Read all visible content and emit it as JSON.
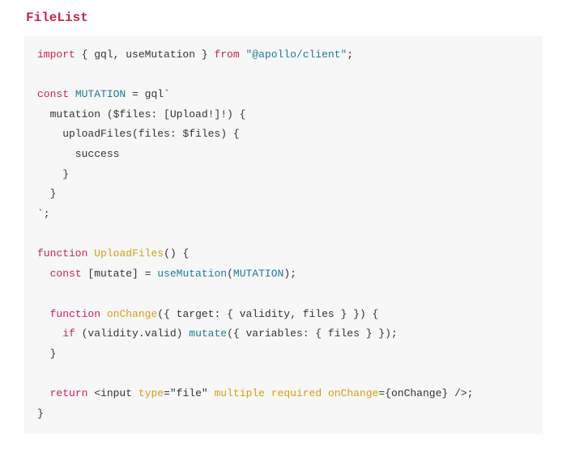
{
  "title": "FileList",
  "code": {
    "l1": {
      "kw1": "import",
      "p1": " { gql, useMutation } ",
      "kw2": "from",
      "p2": " ",
      "str": "\"@apollo/client\"",
      "p3": ";"
    },
    "l2": "",
    "l3": {
      "kw": "const",
      "sp": " ",
      "name": "MUTATION",
      "eq": " = gql`"
    },
    "l4": "  mutation ($files: [Upload!]!) {",
    "l5": "    uploadFiles(files: $files) {",
    "l6": "      success",
    "l7": "    }",
    "l8": "  }",
    "l9": "`;",
    "l10": "",
    "l11": {
      "kw": "function",
      "sp": " ",
      "name": "UploadFiles",
      "rest": "() {"
    },
    "l12": {
      "ind": "  ",
      "kw": "const",
      "p1": " [mutate] = ",
      "fn": "useMutation",
      "p2": "(",
      "arg": "MUTATION",
      "p3": ");"
    },
    "l13": "",
    "l14": {
      "ind": "  ",
      "kw": "function",
      "sp": " ",
      "name": "onChange",
      "rest": "({ target: { validity, files } }) {"
    },
    "l15": {
      "ind": "    ",
      "kw": "if",
      "p1": " (validity.valid) ",
      "fn": "mutate",
      "p2": "({ variables: { files } });"
    },
    "l16": "  }",
    "l17": "",
    "l18": {
      "ind": "  ",
      "kw": "return",
      "p1": " <input ",
      "a1": "type",
      "v1": "=\"file\"",
      "sp1": " ",
      "a2": "multiple",
      "sp2": " ",
      "a3": "required",
      "sp3": " ",
      "a4": "onChange",
      "v4": "={onChange} />;"
    },
    "l19": "}"
  }
}
